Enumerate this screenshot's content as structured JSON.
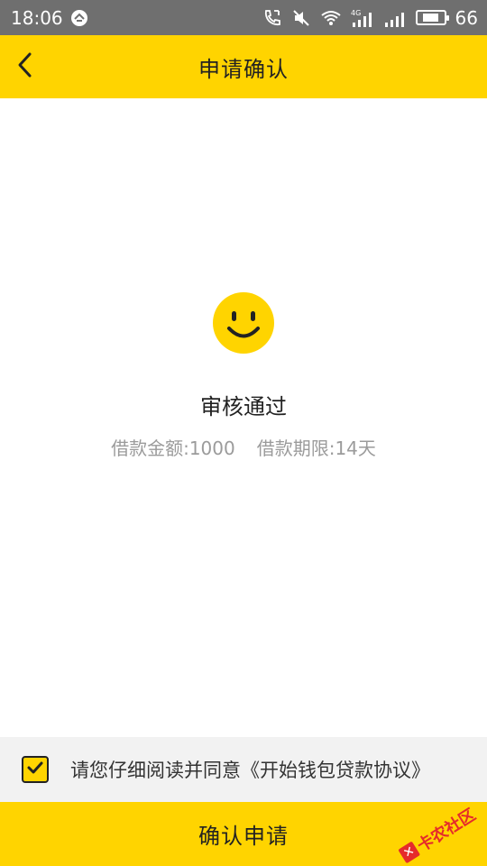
{
  "status_bar": {
    "time": "18:06",
    "battery_level": "66",
    "network_label": "4G",
    "icons": [
      "app-notification-icon",
      "call-icon",
      "mute-icon",
      "wifi-icon",
      "signal-4g-icon",
      "signal-icon",
      "battery-icon"
    ]
  },
  "header": {
    "title": "申请确认",
    "back_icon": "chevron-left-icon",
    "background_color": "#FFD400"
  },
  "result": {
    "icon": "smiley-icon",
    "title": "审核通过",
    "loan_amount": "借款金额:1000",
    "loan_term": "借款期限:14天"
  },
  "agreement": {
    "checked": true,
    "text": "请您仔细阅读并同意",
    "link_text": "《开始钱包贷款协议》"
  },
  "confirm_button": {
    "label": "确认申请"
  },
  "watermark": {
    "text": "卡农社区"
  },
  "colors": {
    "accent": "#FFD400",
    "status_bar": "#6f6f6f",
    "secondary_text": "#9b9b9b"
  }
}
